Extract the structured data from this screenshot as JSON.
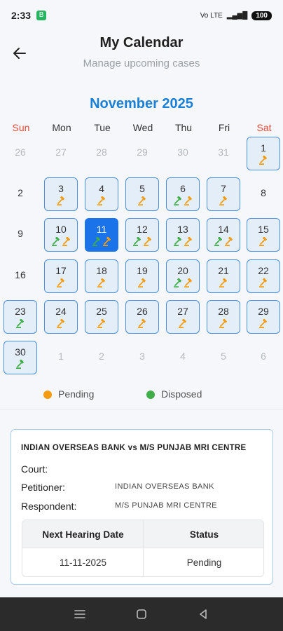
{
  "status": {
    "time": "2:33",
    "signal_text": "Vo LTE",
    "battery": "100"
  },
  "header": {
    "title": "My Calendar",
    "subtitle": "Manage upcoming cases"
  },
  "calendar": {
    "month_label": "November 2025",
    "weekdays": [
      "Sun",
      "Mon",
      "Tue",
      "Wed",
      "Thu",
      "Fri",
      "Sat"
    ],
    "days": [
      {
        "n": "26",
        "m": true,
        "e": []
      },
      {
        "n": "27",
        "m": true,
        "e": []
      },
      {
        "n": "28",
        "m": true,
        "e": []
      },
      {
        "n": "29",
        "m": true,
        "e": []
      },
      {
        "n": "30",
        "m": true,
        "e": []
      },
      {
        "n": "31",
        "m": true,
        "e": []
      },
      {
        "n": "1",
        "m": false,
        "e": [
          "pending"
        ]
      },
      {
        "n": "2",
        "m": false,
        "e": []
      },
      {
        "n": "3",
        "m": false,
        "e": [
          "pending"
        ]
      },
      {
        "n": "4",
        "m": false,
        "e": [
          "pending"
        ]
      },
      {
        "n": "5",
        "m": false,
        "e": [
          "pending"
        ]
      },
      {
        "n": "6",
        "m": false,
        "e": [
          "disposed",
          "pending"
        ]
      },
      {
        "n": "7",
        "m": false,
        "e": [
          "pending"
        ]
      },
      {
        "n": "8",
        "m": false,
        "e": []
      },
      {
        "n": "9",
        "m": false,
        "e": []
      },
      {
        "n": "10",
        "m": false,
        "e": [
          "disposed",
          "pending"
        ]
      },
      {
        "n": "11",
        "m": false,
        "sel": true,
        "e": [
          "disposed",
          "pending"
        ]
      },
      {
        "n": "12",
        "m": false,
        "e": [
          "disposed",
          "pending"
        ]
      },
      {
        "n": "13",
        "m": false,
        "e": [
          "disposed",
          "pending"
        ]
      },
      {
        "n": "14",
        "m": false,
        "e": [
          "disposed",
          "pending"
        ]
      },
      {
        "n": "15",
        "m": false,
        "e": [
          "pending"
        ]
      },
      {
        "n": "16",
        "m": false,
        "e": []
      },
      {
        "n": "17",
        "m": false,
        "e": [
          "pending"
        ]
      },
      {
        "n": "18",
        "m": false,
        "e": [
          "pending"
        ]
      },
      {
        "n": "19",
        "m": false,
        "e": [
          "pending"
        ]
      },
      {
        "n": "20",
        "m": false,
        "e": [
          "disposed",
          "pending"
        ]
      },
      {
        "n": "21",
        "m": false,
        "e": [
          "pending"
        ]
      },
      {
        "n": "22",
        "m": false,
        "e": [
          "pending"
        ]
      },
      {
        "n": "23",
        "m": false,
        "e": [
          "disposed"
        ]
      },
      {
        "n": "24",
        "m": false,
        "e": [
          "pending"
        ]
      },
      {
        "n": "25",
        "m": false,
        "e": [
          "pending"
        ]
      },
      {
        "n": "26",
        "m": false,
        "e": [
          "pending"
        ]
      },
      {
        "n": "27",
        "m": false,
        "e": [
          "pending"
        ]
      },
      {
        "n": "28",
        "m": false,
        "e": [
          "pending"
        ]
      },
      {
        "n": "29",
        "m": false,
        "e": [
          "pending"
        ]
      },
      {
        "n": "30",
        "m": false,
        "e": [
          "disposed"
        ]
      },
      {
        "n": "1",
        "m": true,
        "e": []
      },
      {
        "n": "2",
        "m": true,
        "e": []
      },
      {
        "n": "3",
        "m": true,
        "e": []
      },
      {
        "n": "4",
        "m": true,
        "e": []
      },
      {
        "n": "5",
        "m": true,
        "e": []
      },
      {
        "n": "6",
        "m": true,
        "e": []
      }
    ]
  },
  "legend": [
    {
      "label": "Pending",
      "color": "#f39c12"
    },
    {
      "label": "Disposed",
      "color": "#3fae49"
    }
  ],
  "case": {
    "title": "INDIAN OVERSEAS BANK vs M/S PUNJAB MRI CENTRE",
    "court_label": "Court:",
    "court_value": "",
    "petitioner_label": "Petitioner:",
    "petitioner_value": "INDIAN OVERSEAS BANK",
    "respondent_label": "Respondent:",
    "respondent_value": "M/S PUNJAB MRI CENTRE",
    "table_headers": [
      "Next Hearing Date",
      "Status"
    ],
    "table_row": [
      "11-11-2025",
      "Pending"
    ]
  },
  "colors": {
    "accent": "#1a73e8",
    "pending": "#f39c12",
    "disposed": "#3fae49"
  },
  "nav": [
    "menu-icon",
    "home-square-icon",
    "back-triangle-icon"
  ]
}
